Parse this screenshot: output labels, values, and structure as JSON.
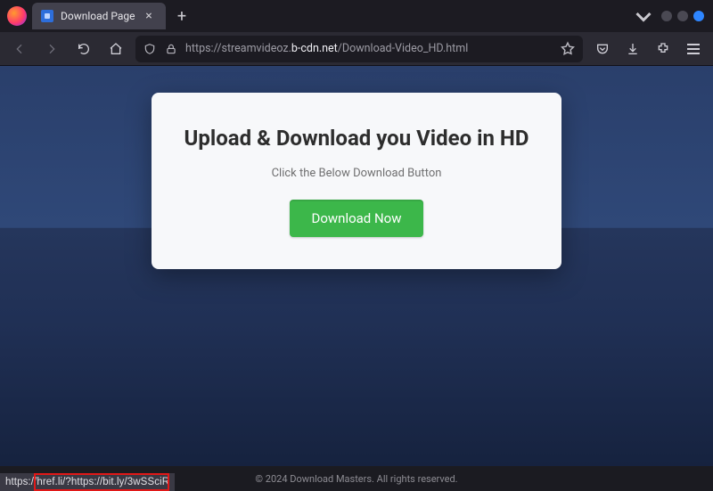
{
  "browser": {
    "tab_title": "Download Page",
    "url_prefix": "https://streamvideoz.",
    "url_domain": "b-cdn.net",
    "url_path": "/Download-Video_HD.html"
  },
  "page": {
    "heading": "Upload & Download you Video in HD",
    "subtext": "Click the Below Download Button",
    "button_label": "Download Now",
    "footer": "© 2024 Download Masters. All rights reserved."
  },
  "status": {
    "link_preview": "https://href.li/?https://bit.ly/3wSSciR"
  }
}
